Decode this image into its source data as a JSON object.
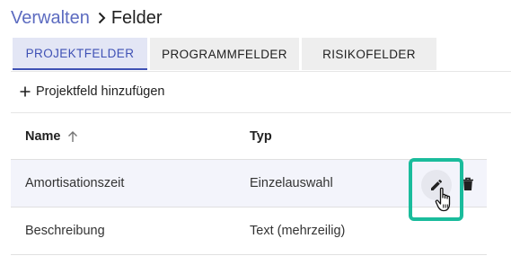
{
  "breadcrumb": {
    "parent": "Verwalten",
    "current": "Felder",
    "separator_icon": "chevron-right-icon"
  },
  "tabs": [
    {
      "label": "PROJEKTFELDER",
      "active": true
    },
    {
      "label": "PROGRAMMFELDER",
      "active": false
    },
    {
      "label": "RISIKOFELDER",
      "active": false
    }
  ],
  "actions": {
    "add_field_label": "Projektfeld hinzufügen",
    "add_icon": "plus-icon"
  },
  "table": {
    "columns": [
      {
        "label": "Name",
        "sort": "ascending",
        "sort_icon": "arrow-up-icon"
      },
      {
        "label": "Typ"
      }
    ],
    "rows": [
      {
        "name": "Amortisationszeit",
        "type": "Einzelauswahl",
        "hovered": true
      },
      {
        "name": "Beschreibung",
        "type": "Text (mehrzeilig)",
        "hovered": false
      }
    ],
    "row_actions": {
      "edit_icon": "pencil-icon",
      "delete_icon": "trash-icon"
    }
  },
  "colors": {
    "accent": "#3f51b5",
    "breadcrumb_link": "#5c6bc0",
    "highlight": "#1abc9c"
  }
}
